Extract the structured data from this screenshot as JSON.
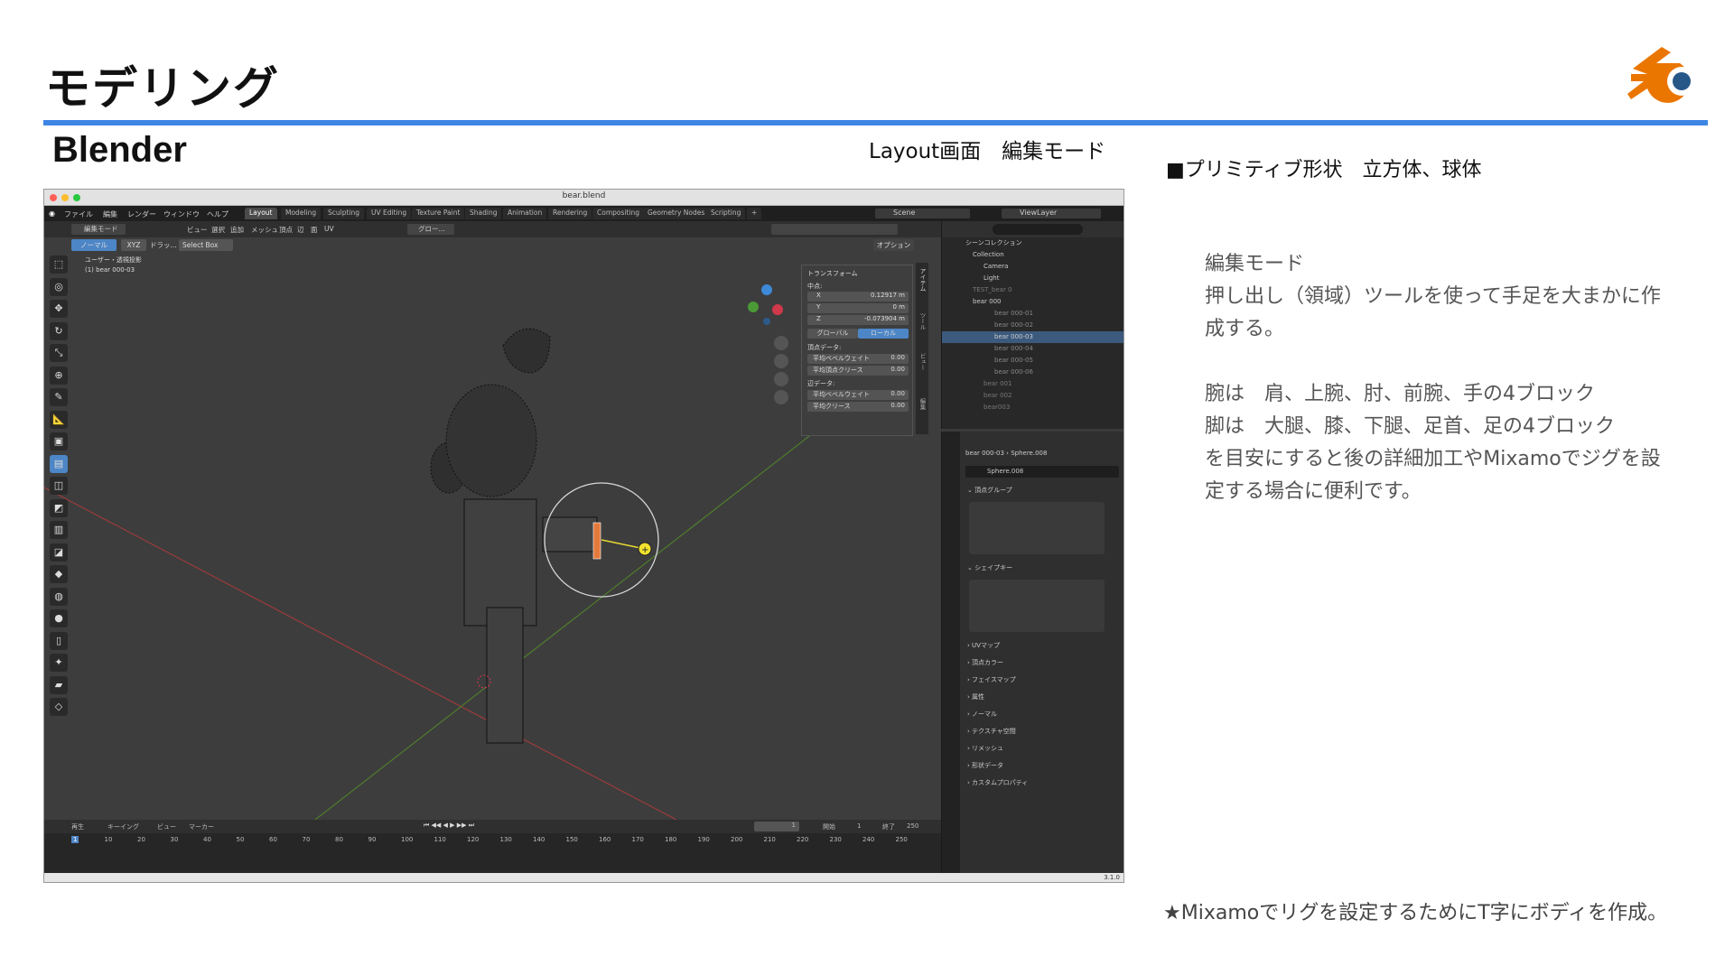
{
  "slide": {
    "title": "モデリング",
    "subtitle": "Blender",
    "caption": "Layout画面　編集モード",
    "primitive_heading": "■プリミティブ形状　立方体、球体",
    "body_lines": [
      "編集モード",
      "押し出し（領域）ツールを使って手足を大まかに作",
      "成する。",
      "",
      "腕は　肩、上腕、肘、前腕、手の4ブロック",
      "脚は　大腿、膝、下腿、足首、足の4ブロック",
      "を目安にすると後の詳細加工やMixamoでジグを設",
      "定する場合に便利です。"
    ],
    "footnote": "★Mixamoでリグを設定するためにT字にボディを作成。",
    "accent_color": "#3d86e4",
    "logo_icon": "blender-logo-icon"
  },
  "blender": {
    "window_title": "bear.blend",
    "menu": [
      "ファイル",
      "編集",
      "レンダー",
      "ウィンドウ",
      "ヘルプ"
    ],
    "workspaces": [
      "Layout",
      "Modeling",
      "Sculpting",
      "UV Editing",
      "Texture Paint",
      "Shading",
      "Animation",
      "Rendering",
      "Compositing",
      "Geometry Nodes",
      "Scripting"
    ],
    "active_workspace": "Layout",
    "scene": "Scene",
    "view_layer": "ViewLayer",
    "viewport_header": {
      "mode": "編集モード",
      "menus": [
        "ビュー",
        "選択",
        "追加",
        "メッシュ",
        "頂点",
        "辺",
        "面",
        "UV"
      ],
      "orientation": "グロー...",
      "transform_pivot": "ノーマル",
      "axis": "XYZ",
      "drag": "ドラッ...",
      "select_box": "Select Box",
      "options": "オプション"
    },
    "viewport_info": [
      "ユーザー・透視投影",
      "(1) bear 000-03"
    ],
    "transform_panel": {
      "title": "トランスフォーム",
      "median": "中点:",
      "x_label": "X",
      "x_value": "0.12917 m",
      "y_label": "Y",
      "y_value": "0 m",
      "z_label": "Z",
      "z_value": "-0.073904 m",
      "global": "グローバル",
      "local": "ローカル",
      "vertex_data": "頂点データ:",
      "mean_bevel_weight": "平均ベベルウェイト",
      "mean_bevel_weight_value": "0.00",
      "mean_vertex_crease": "平均頂点クリース",
      "mean_vertex_crease_value": "0.00",
      "edge_data": "辺データ:",
      "edge_bevel_weight": "平均ベベルウェイト",
      "edge_bevel_weight_value": "0.00",
      "edge_crease": "平均クリース",
      "edge_crease_value": "0.00"
    },
    "side_tabs": [
      "アイテム",
      "ツール",
      "ビュー",
      "編集"
    ],
    "outliner": {
      "title": "シーンコレクション",
      "items": [
        "Collection",
        "Camera",
        "Light",
        "TEST_bear 0",
        "bear 000",
        "bear 000-01",
        "bear 000-02",
        "bear 000-03",
        "bear 000-04",
        "bear 000-05",
        "bear 000-06",
        "bear 001",
        "bear 002",
        "bear003"
      ],
      "selected": "bear 000-03"
    },
    "properties": {
      "breadcrumb_object": "bear 000-03",
      "breadcrumb_mesh": "Sphere.008",
      "mesh_name": "Sphere.008",
      "vertex_groups": "頂点グループ",
      "shape_keys": "シェイプキー",
      "panels": [
        "UVマップ",
        "頂点カラー",
        "フェイスマップ",
        "属性",
        "ノーマル",
        "テクスチャ空間",
        "リメッシュ",
        "形状データ",
        "カスタムプロパティ"
      ]
    },
    "timeline": {
      "playback": "再生",
      "keying": "キーイング",
      "view": "ビュー",
      "marker": "マーカー",
      "current_frame": "1",
      "start_label": "開始",
      "start": "1",
      "end_label": "終了",
      "end": "250",
      "ticks": [
        "1",
        "10",
        "20",
        "30",
        "40",
        "50",
        "60",
        "70",
        "80",
        "90",
        "100",
        "110",
        "120",
        "130",
        "140",
        "150",
        "160",
        "170",
        "180",
        "190",
        "200",
        "210",
        "220",
        "230",
        "240",
        "250"
      ]
    },
    "version": "3.1.0"
  }
}
